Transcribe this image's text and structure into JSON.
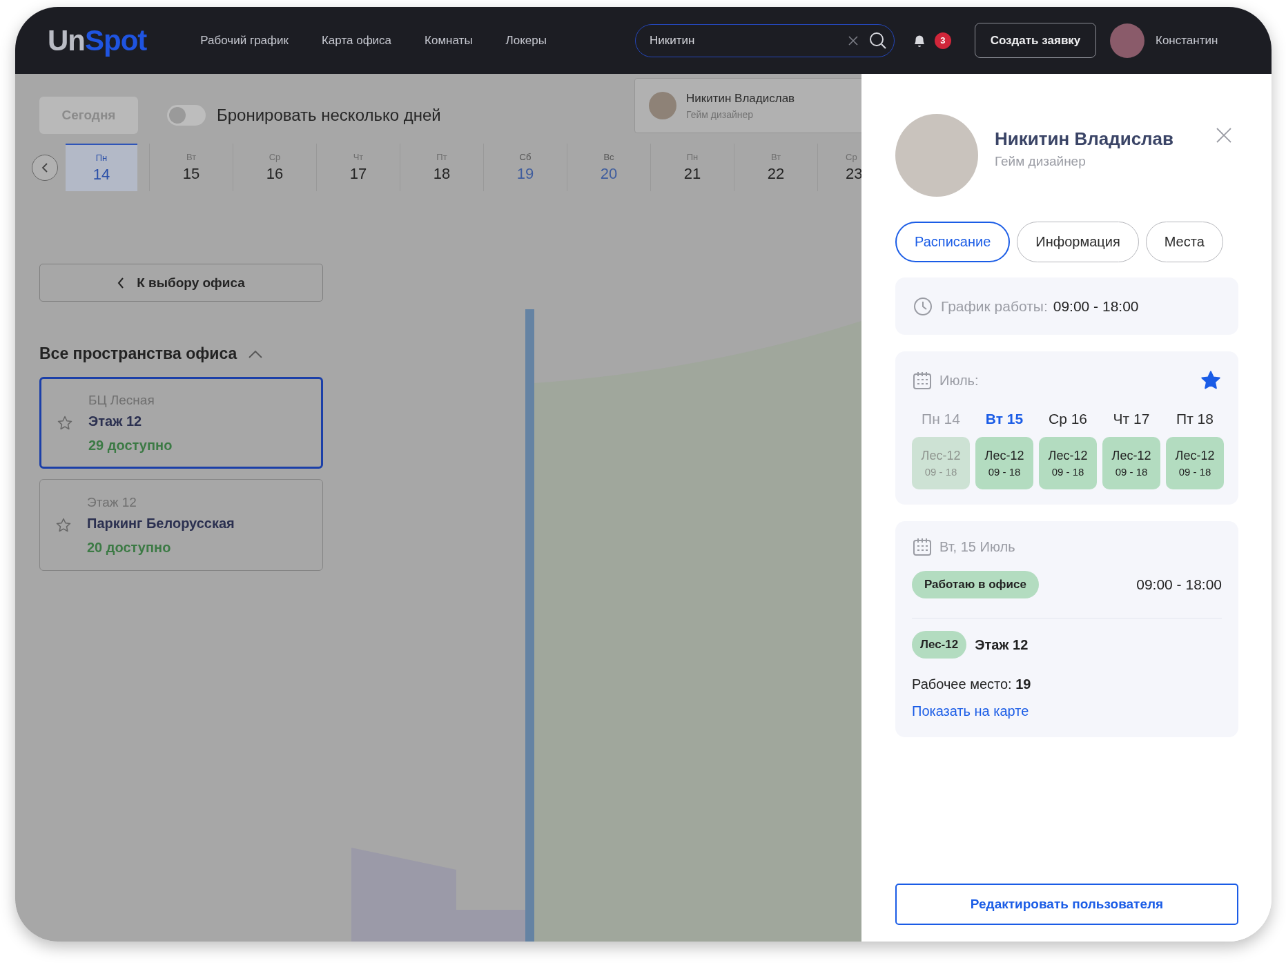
{
  "header": {
    "logo": [
      "Un",
      "Spot"
    ],
    "nav": [
      {
        "label": "Рабочий график"
      },
      {
        "label": "Карта офиса"
      },
      {
        "label": "Комнаты"
      },
      {
        "label": "Локеры"
      }
    ],
    "search": {
      "value": "Никитин"
    },
    "notifications": {
      "count": "3"
    },
    "create_button": "Создать заявку",
    "user": {
      "name": "Константин"
    }
  },
  "toolbar": {
    "today_button": "Сегодня",
    "multi_day_toggle": {
      "label": "Бронировать несколько дней",
      "on": false
    }
  },
  "search_result": {
    "name": "Никитин Владислав",
    "role": "Гейм дизайнер"
  },
  "days": [
    {
      "weekday": "Пн",
      "date": "14",
      "selected": true,
      "weekend": false
    },
    {
      "weekday": "Вт",
      "date": "15",
      "selected": false,
      "weekend": false
    },
    {
      "weekday": "Ср",
      "date": "16",
      "selected": false,
      "weekend": false
    },
    {
      "weekday": "Чт",
      "date": "17",
      "selected": false,
      "weekend": false
    },
    {
      "weekday": "Пт",
      "date": "18",
      "selected": false,
      "weekend": false
    },
    {
      "weekday": "Сб",
      "date": "19",
      "selected": false,
      "weekend": true
    },
    {
      "weekday": "Вс",
      "date": "20",
      "selected": false,
      "weekend": true
    },
    {
      "weekday": "Пн",
      "date": "21",
      "selected": false,
      "weekend": false
    },
    {
      "weekday": "Вт",
      "date": "22",
      "selected": false,
      "weekend": false
    },
    {
      "weekday": "Ср",
      "date": "23",
      "selected": false,
      "weekend": false
    }
  ],
  "sidebar": {
    "back_button": "К выбору офиса",
    "section_title": "Все пространства офиса",
    "expanded": true,
    "spaces": [
      {
        "place": "БЦ Лесная",
        "name": "Этаж 12",
        "available": "29 доступно",
        "selected": true,
        "favorite": false
      },
      {
        "place": "Этаж 12",
        "name": "Паркинг Белорусская",
        "available": "20 доступно",
        "selected": false,
        "favorite": false
      }
    ]
  },
  "profile": {
    "name": "Никитин Владислав",
    "role": "Гейм дизайнер",
    "tabs": [
      {
        "label": "Расписание",
        "selected": true
      },
      {
        "label": "Информация",
        "selected": false
      },
      {
        "label": "Места",
        "selected": false
      }
    ],
    "work_hours": {
      "label": "График работы:",
      "value": "09:00 - 18:00"
    },
    "month": {
      "label": "Июль:",
      "favorite": true,
      "days": [
        {
          "label": "Пн 14",
          "selected": false,
          "past": true,
          "place": "Лес-12",
          "hours": "09 - 18"
        },
        {
          "label": "Вт 15",
          "selected": true,
          "past": false,
          "place": "Лес-12",
          "hours": "09 - 18"
        },
        {
          "label": "Ср 16",
          "selected": false,
          "past": false,
          "place": "Лес-12",
          "hours": "09 - 18"
        },
        {
          "label": "Чт 17",
          "selected": false,
          "past": false,
          "place": "Лес-12",
          "hours": "09 - 18"
        },
        {
          "label": "Пт 18",
          "selected": false,
          "past": false,
          "place": "Лес-12",
          "hours": "09 - 18"
        }
      ]
    },
    "day_detail": {
      "date": "Вт, 15 Июль",
      "status": "Работаю в офисе",
      "hours": "09:00 - 18:00",
      "place_tag": "Лес-12",
      "floor": "Этаж 12",
      "workplace": "Рабочее место: **19**",
      "map_link": "Показать на карте"
    },
    "edit_button": "Редактировать пользователя"
  }
}
